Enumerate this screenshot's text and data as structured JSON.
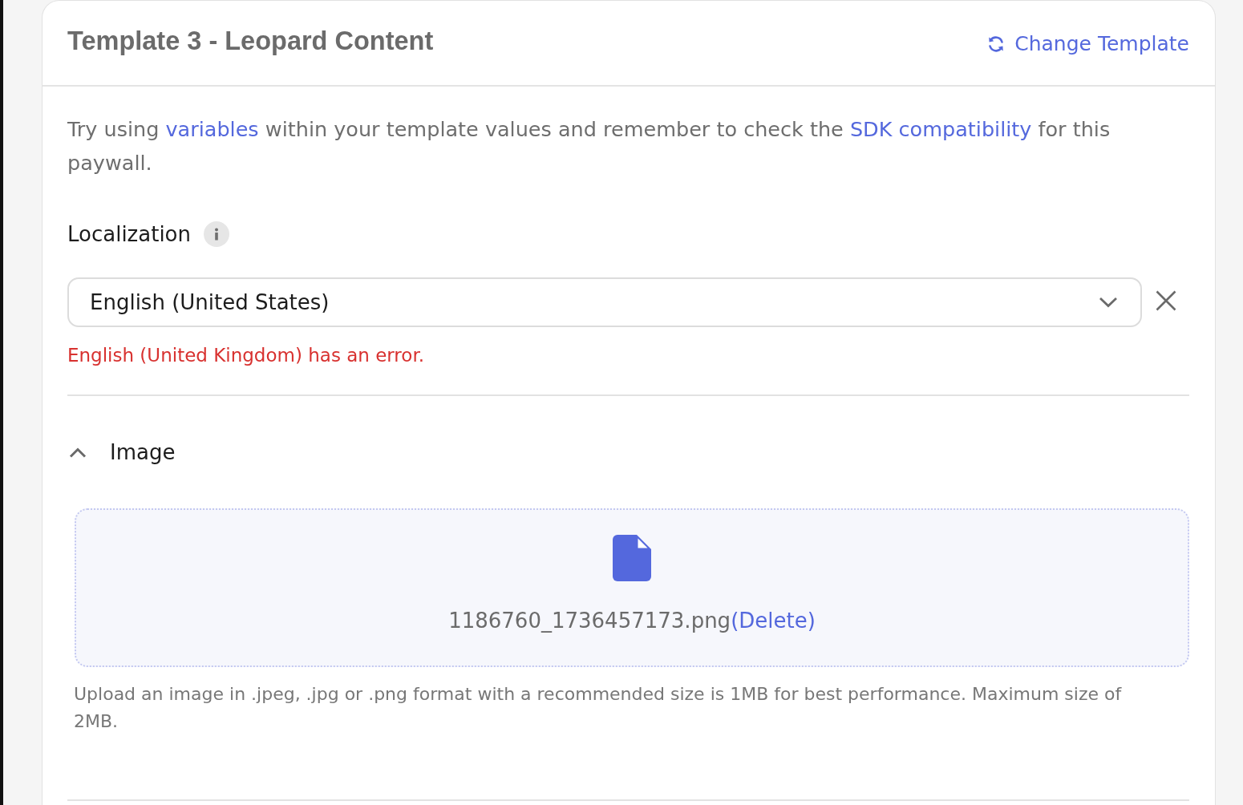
{
  "header": {
    "title": "Template 3 - Leopard Content",
    "action": "Change Template"
  },
  "intro": [
    {
      "kind": "text",
      "text": "Try using "
    },
    {
      "kind": "link",
      "text": "variables"
    },
    {
      "kind": "text",
      "text": " within your template values and remember to check the "
    },
    {
      "kind": "link",
      "text": "SDK compatibility"
    },
    {
      "kind": "text",
      "text": " for this paywall."
    }
  ],
  "localization": {
    "label": "Localization",
    "select": {
      "value": "English (United States)"
    },
    "error": "English (United Kingdom) has an error."
  },
  "image_section": {
    "title": "Image",
    "expanded": true,
    "file": {
      "name": "1186760_1736457173.png",
      "action": "(Delete)"
    },
    "hint": "Upload an image in .jpeg, .jpg or .png format with a recommended size is 1MB for best performance. Maximum size of 2MB."
  }
}
